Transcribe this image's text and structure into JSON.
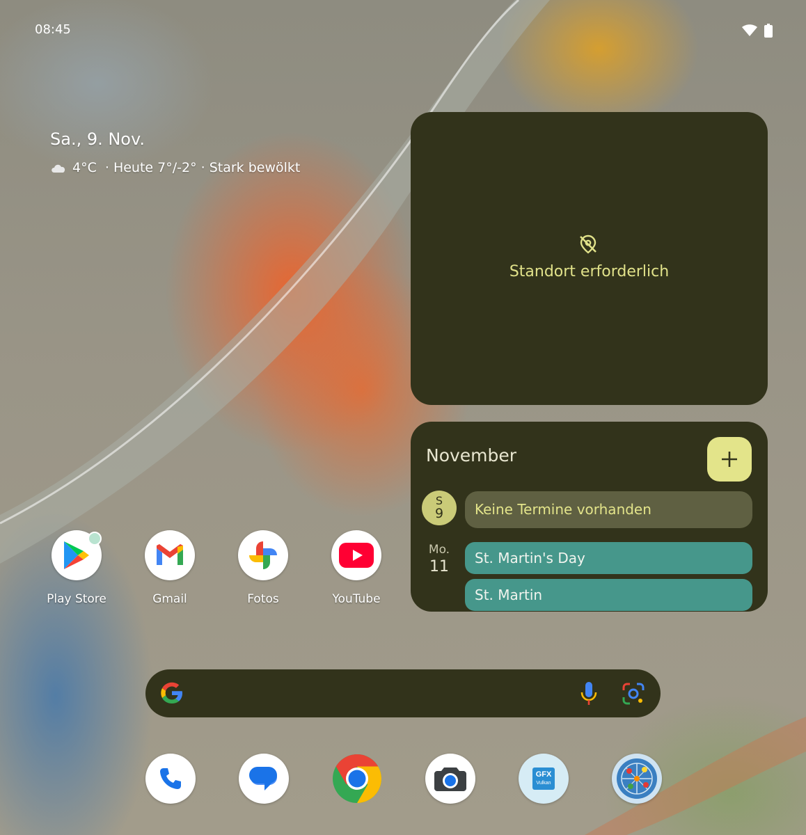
{
  "status_bar": {
    "time": "08:45",
    "icons": [
      "wifi-icon",
      "battery-icon"
    ]
  },
  "glance": {
    "date": "Sa., 9. Nov.",
    "temperature": "4°C",
    "forecast": "· Heute 7°/-2° · Stark bewölkt",
    "weather_icon": "cloud-icon"
  },
  "weather_widget": {
    "message": "Standort erforderlich",
    "icon": "location-off-icon"
  },
  "calendar_widget": {
    "month": "November",
    "add_icon": "plus-icon",
    "days": [
      {
        "weekday": "S",
        "day": "9",
        "events": [
          "Keine Termine vorhanden"
        ]
      },
      {
        "weekday": "Mo.",
        "day": "11",
        "events": [
          "St. Martin's Day",
          "St. Martin"
        ]
      }
    ]
  },
  "apps": [
    {
      "label": "Play Store",
      "icon": "play-store-icon"
    },
    {
      "label": "Gmail",
      "icon": "gmail-icon"
    },
    {
      "label": "Fotos",
      "icon": "photos-icon"
    },
    {
      "label": "YouTube",
      "icon": "youtube-icon"
    }
  ],
  "search_bar": {
    "icons": [
      "google-g-icon",
      "mic-icon",
      "lens-icon"
    ]
  },
  "dock": [
    {
      "name": "phone",
      "icon": "phone-icon"
    },
    {
      "name": "messages",
      "icon": "messages-icon"
    },
    {
      "name": "chrome",
      "icon": "chrome-icon"
    },
    {
      "name": "camera",
      "icon": "camera-icon"
    },
    {
      "name": "gfxbench",
      "icon": "gfx-vulkan-icon",
      "badge_text": "GFX",
      "badge_sub": "Vulkan"
    },
    {
      "name": "network",
      "icon": "network-icon"
    }
  ],
  "colors": {
    "widget_bg": "#32331b",
    "accent_yellow": "#e3e48a",
    "event_teal": "#46978b"
  }
}
